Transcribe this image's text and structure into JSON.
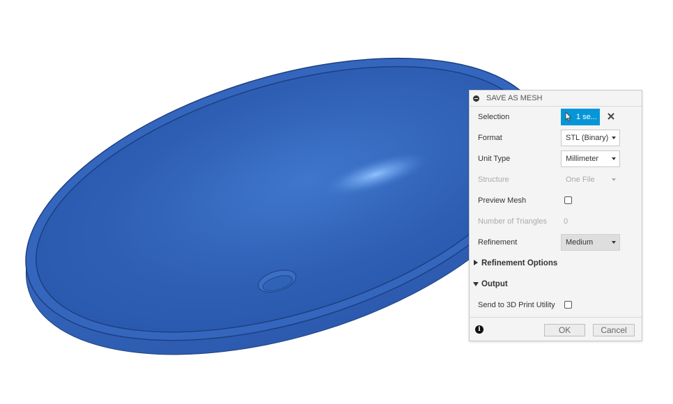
{
  "colors": {
    "accent": "#0696d7",
    "model_blue": "#2f63b8",
    "panel_bg": "#f4f4f4"
  },
  "dialog": {
    "title": "SAVE AS MESH",
    "rows": {
      "selection": {
        "label": "Selection",
        "value": "1 se...",
        "icon": "cursor-arrow-icon",
        "clear_icon": "close-icon"
      },
      "format": {
        "label": "Format",
        "value": "STL (Binary)"
      },
      "unit_type": {
        "label": "Unit Type",
        "value": "Millimeter"
      },
      "structure": {
        "label": "Structure",
        "value": "One File",
        "enabled": false
      },
      "preview_mesh": {
        "label": "Preview Mesh",
        "checked": false
      },
      "number_of_triangles": {
        "label": "Number of Triangles",
        "value": "0",
        "enabled": false
      },
      "refinement": {
        "label": "Refinement",
        "value": "Medium"
      }
    },
    "sections": {
      "refinement_options": {
        "label": "Refinement Options",
        "expanded": false
      },
      "output": {
        "label": "Output",
        "expanded": true
      }
    },
    "send_to_3d_print": {
      "label": "Send to 3D Print Utility",
      "checked": false
    },
    "footer": {
      "info_icon": "info-icon",
      "ok_label": "OK",
      "cancel_label": "Cancel"
    }
  }
}
